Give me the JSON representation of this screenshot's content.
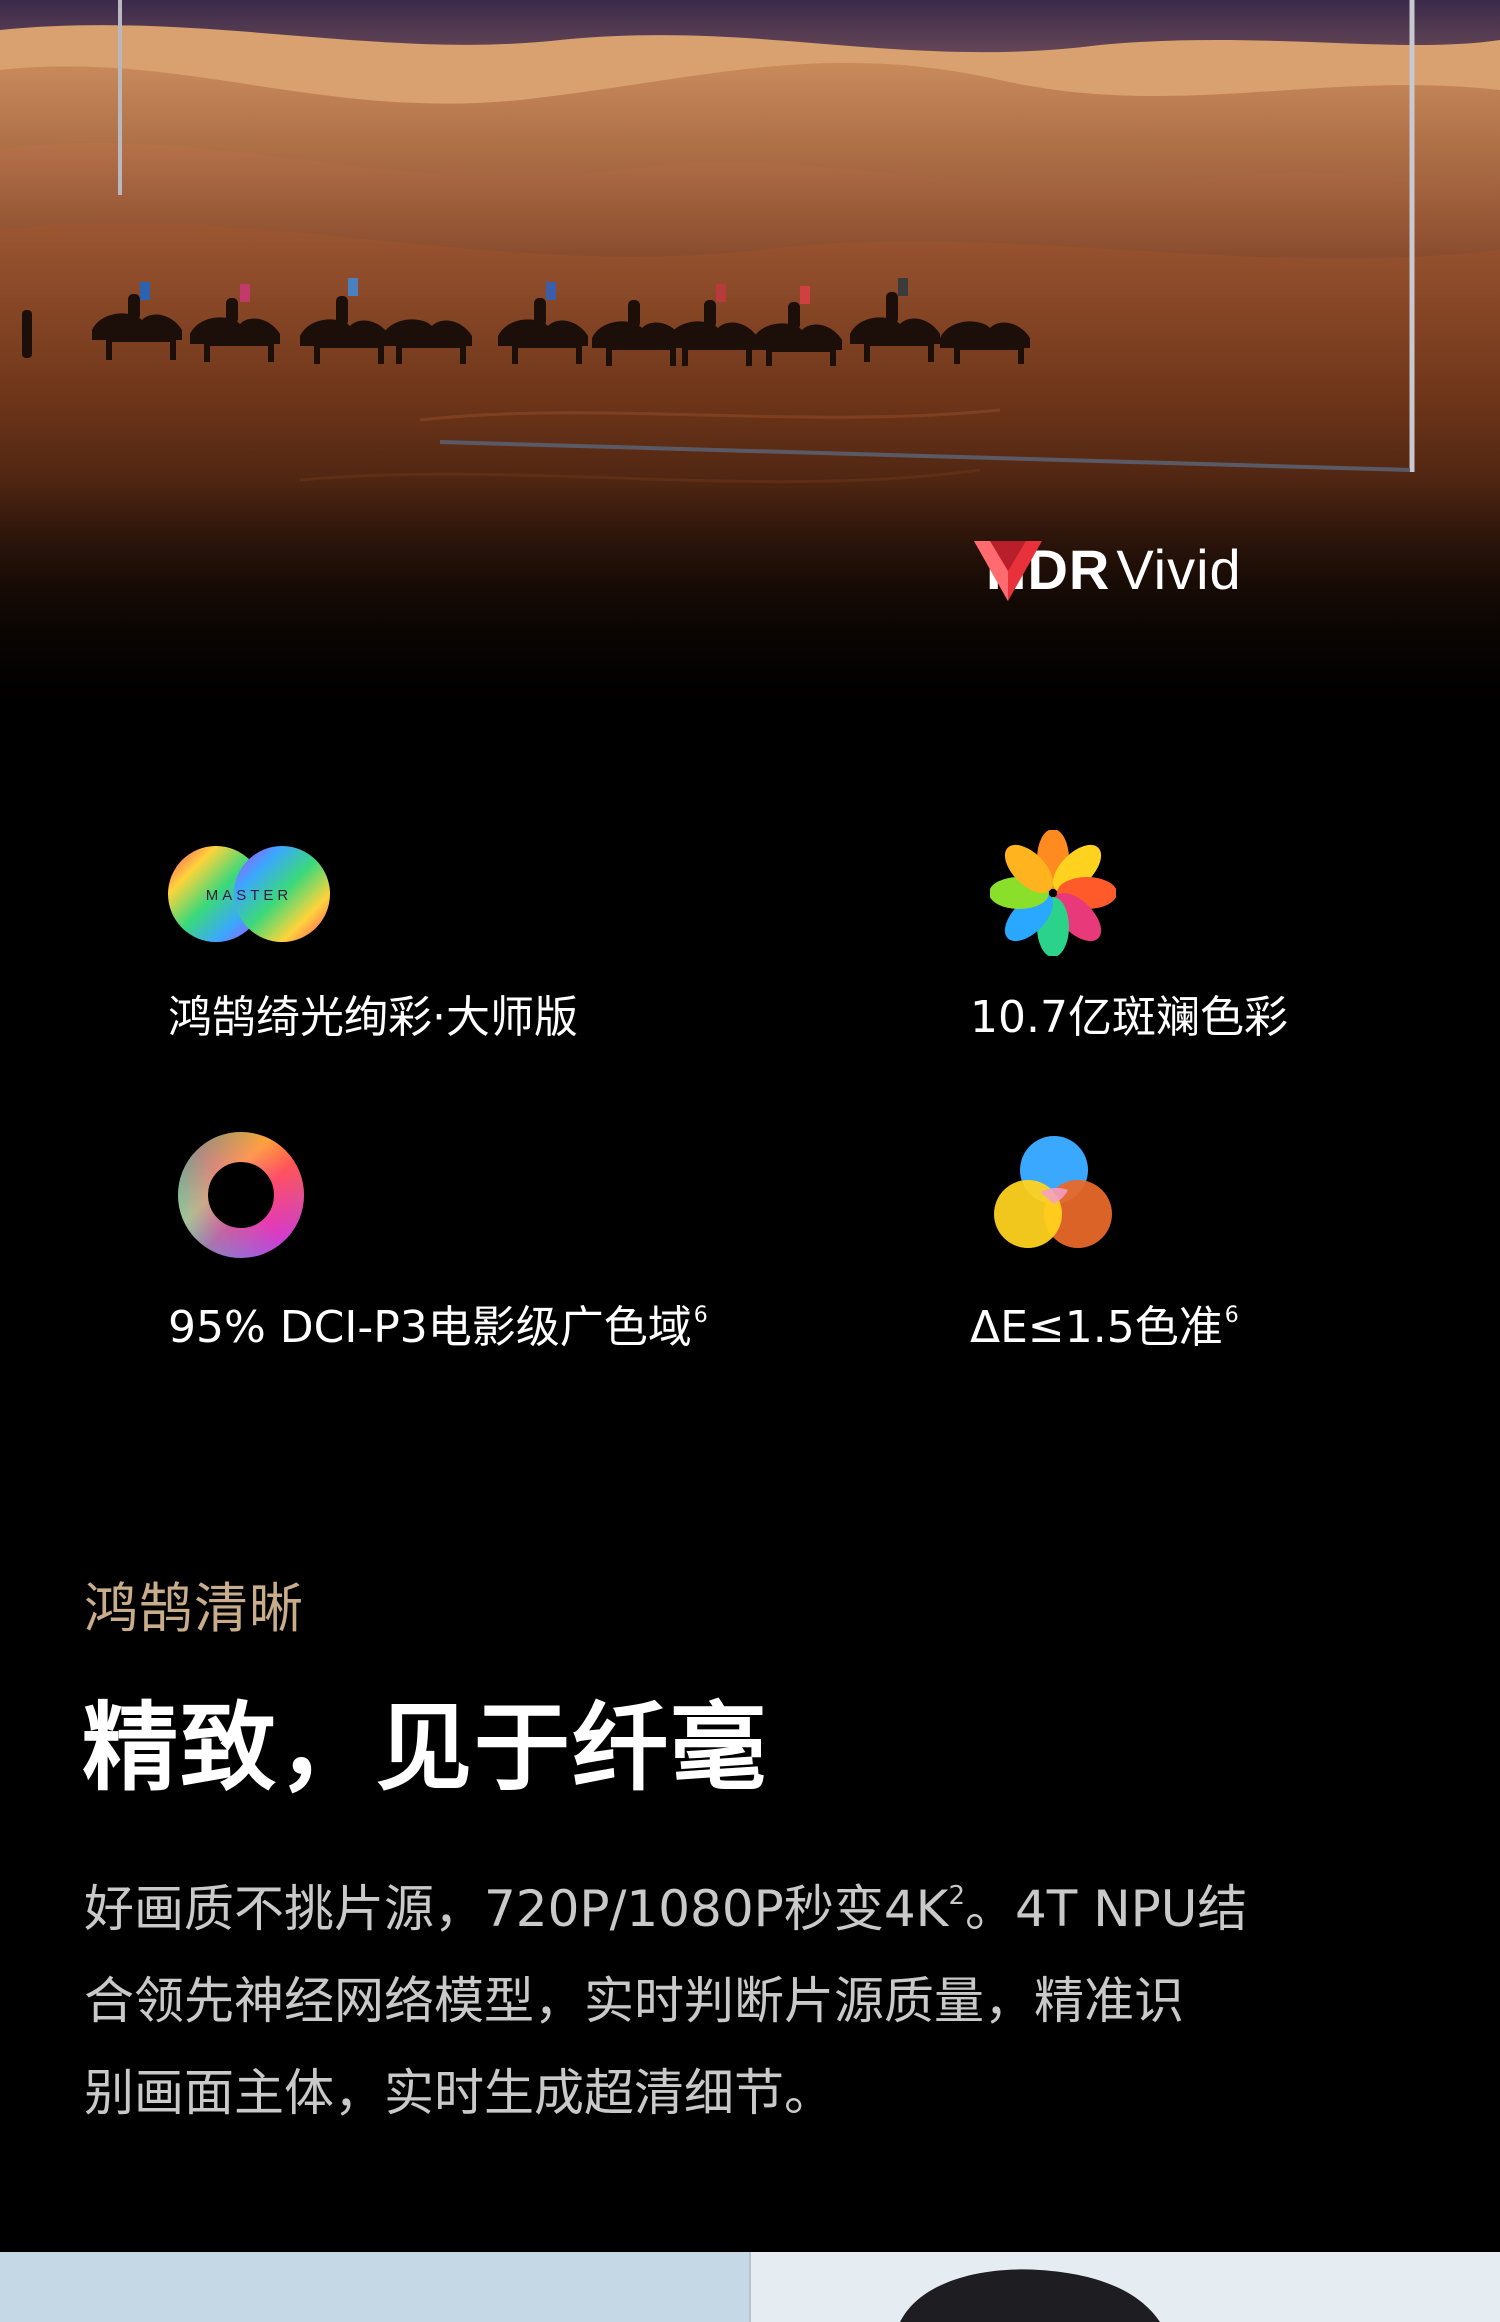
{
  "hero": {
    "badge": {
      "bold": "HDR",
      "light": "Vivid"
    }
  },
  "features": [
    {
      "icon": "master-infinity-icon",
      "icon_text": "MASTER",
      "label": "鸿鹄绮光绚彩·大师版",
      "sup": ""
    },
    {
      "icon": "color-petals-icon",
      "label": "10.7亿斑斓色彩",
      "sup": ""
    },
    {
      "icon": "color-ring-icon",
      "label": "95% DCI-P3电影级广色域",
      "sup": "6"
    },
    {
      "icon": "overlapping-circles-icon",
      "label": "ΔE≤1.5色准",
      "sup": "6"
    }
  ],
  "section": {
    "eyebrow": "鸿鹄清晰",
    "headline": "精致，见于纤毫",
    "body": {
      "line1_a": "好画质不挑片源，720P/1080P秒变4K",
      "line1_sup": "2",
      "line1_b": "。4T NPU结",
      "line2": "合领先神经网络模型，实时判断片源质量，精准识",
      "line3": "别画面主体，实时生成超清细节。"
    }
  },
  "colors": {
    "background": "#000000",
    "eyebrow": "#c9ad8a",
    "body_text": "#c9c9c9",
    "sand": "#a9623a",
    "hdr_red": "#e8313a"
  }
}
